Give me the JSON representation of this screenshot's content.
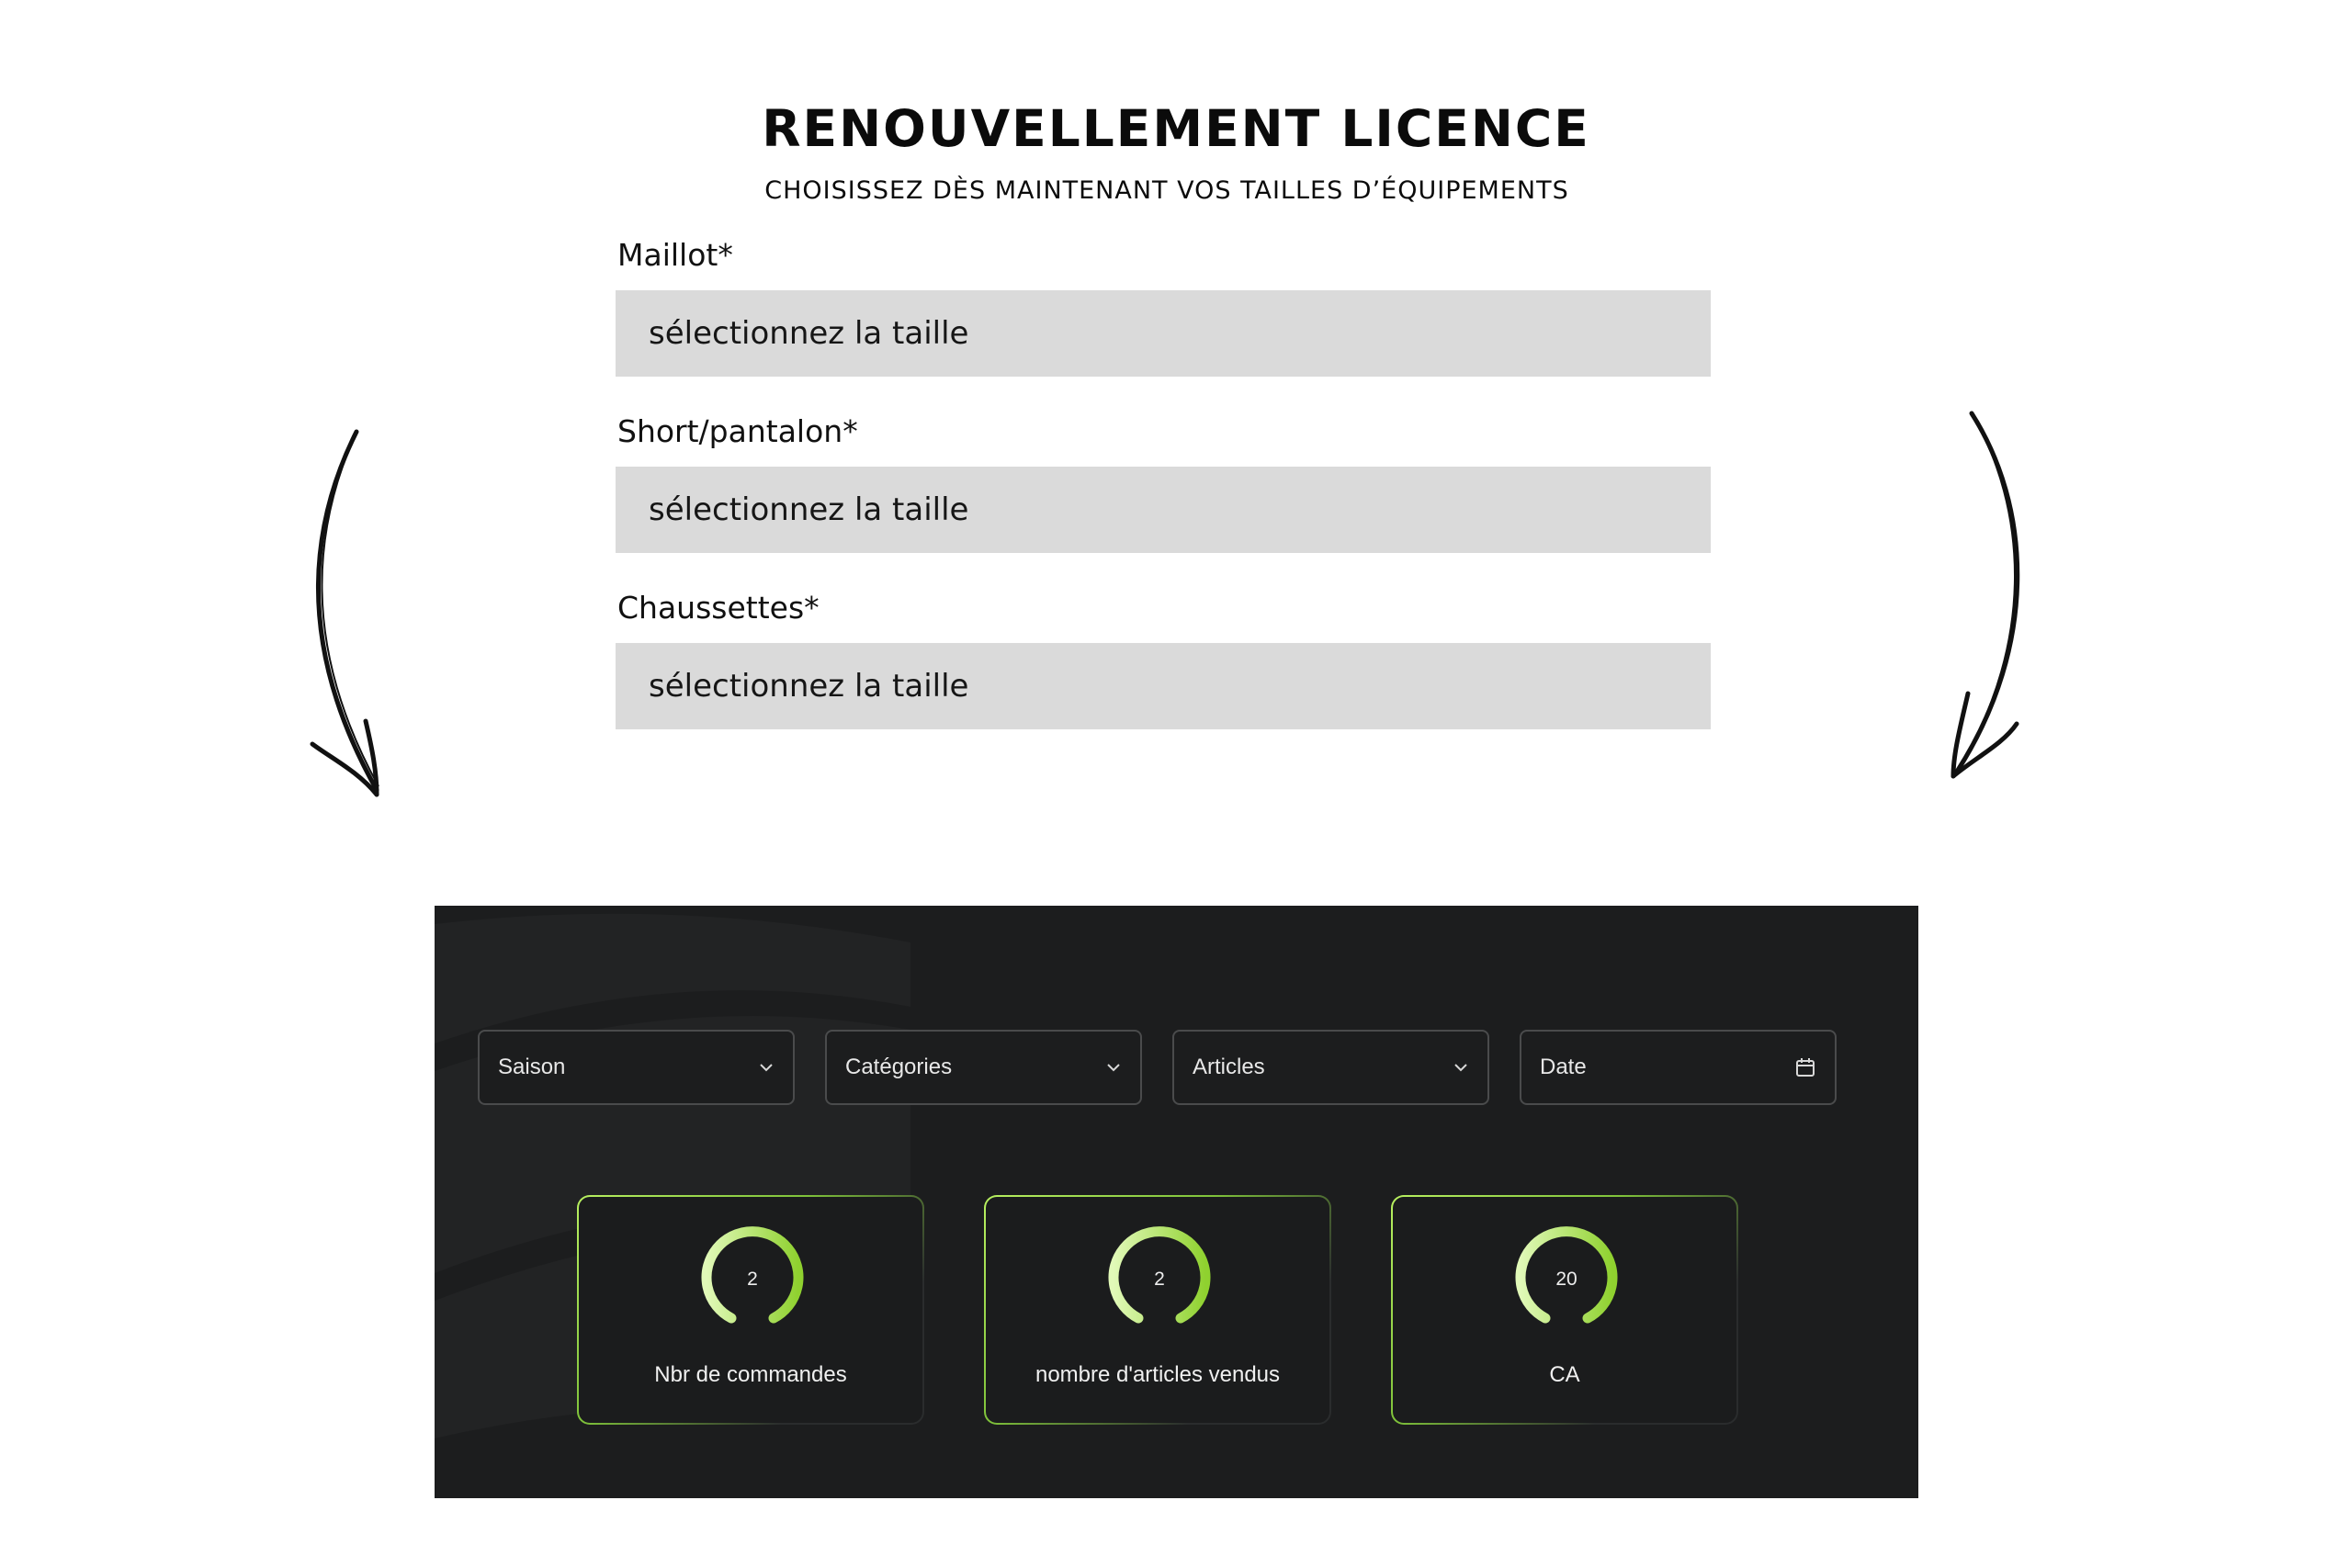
{
  "header": {
    "title": "RENOUVELLEMENT LICENCE",
    "subtitle": "CHOISISSEZ DÈS MAINTENANT VOS TAILLES D’ÉQUIPEMENTS"
  },
  "form": {
    "fields": [
      {
        "label": "Maillot*",
        "value": "sélectionnez la taille"
      },
      {
        "label": "Short/pantalon*",
        "value": "sélectionnez la taille"
      },
      {
        "label": "Chaussettes*",
        "value": "sélectionnez la taille"
      }
    ]
  },
  "decor": {
    "left_arrow_icon": "curved-arrow-down-icon",
    "right_arrow_icon": "curved-arrow-down-icon"
  },
  "dashboard": {
    "filters": [
      {
        "label": "Saison",
        "icon": "chevron-down-icon"
      },
      {
        "label": "Catégories",
        "icon": "chevron-down-icon"
      },
      {
        "label": "Articles",
        "icon": "chevron-down-icon"
      },
      {
        "label": "Date",
        "icon": "calendar-icon"
      }
    ],
    "cards": [
      {
        "value": "2",
        "label": "Nbr de commandes"
      },
      {
        "value": "2",
        "label": "nombre d'articles vendus"
      },
      {
        "value": "20",
        "label": "CA"
      }
    ],
    "colors": {
      "background": "#1c1d1e",
      "accent_light": "#d9f7a8",
      "accent": "#8fd12f"
    }
  }
}
